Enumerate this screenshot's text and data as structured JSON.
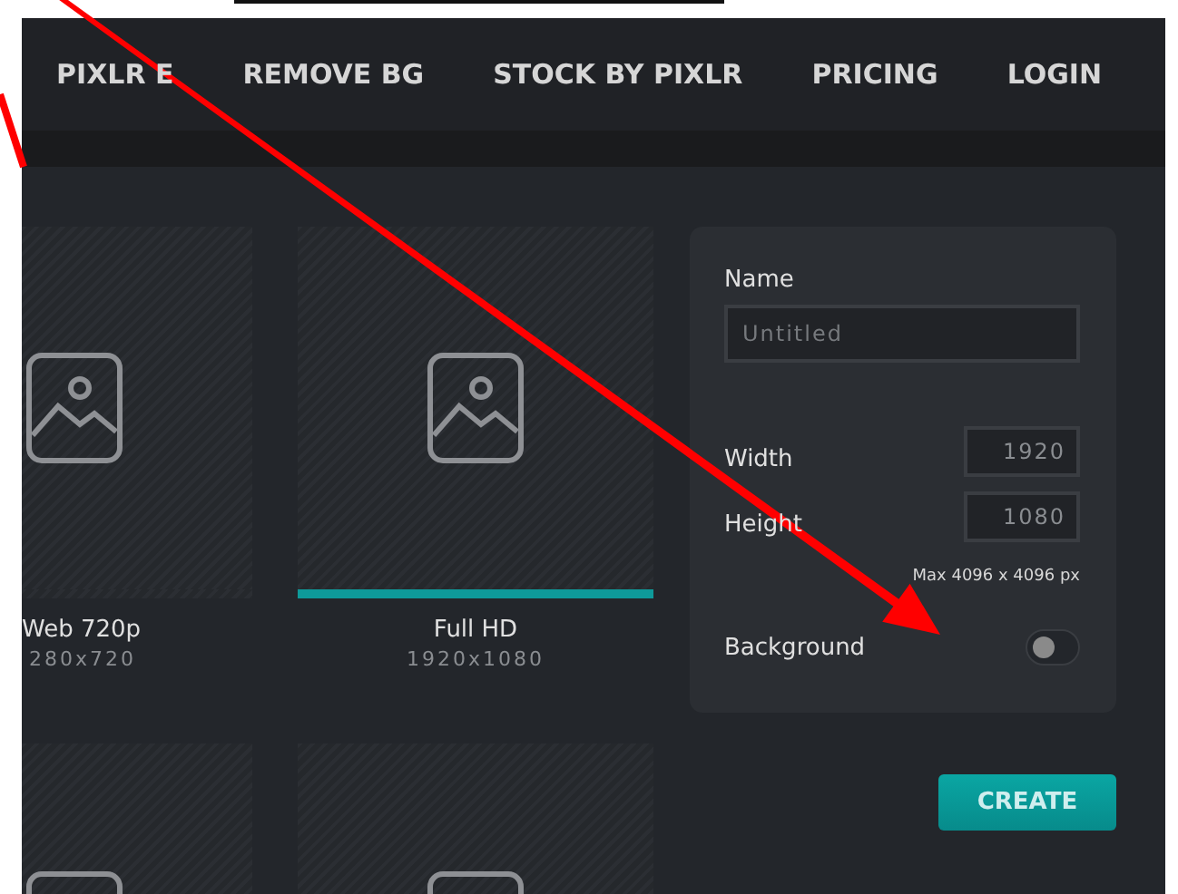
{
  "nav": {
    "items": [
      {
        "label": "PIXLR E"
      },
      {
        "label": "REMOVE BG"
      },
      {
        "label": "STOCK BY PIXLR"
      },
      {
        "label": "PRICING"
      },
      {
        "label": "LOGIN"
      }
    ]
  },
  "presets": [
    {
      "label": "Web 720p",
      "size": "280x720",
      "selected": false,
      "cut": true
    },
    {
      "label": "Full HD",
      "size": "1920x1080",
      "selected": true,
      "cut": false
    },
    {
      "cut": true
    },
    {
      "cut": false
    }
  ],
  "panel": {
    "name_label": "Name",
    "name_placeholder": "Untitled",
    "width_label": "Width",
    "width_value": "1920",
    "height_label": "Height",
    "height_value": "1080",
    "max_note": "Max 4096 x 4096 px",
    "background_label": "Background",
    "background_on": false
  },
  "create_button": "CREATE"
}
